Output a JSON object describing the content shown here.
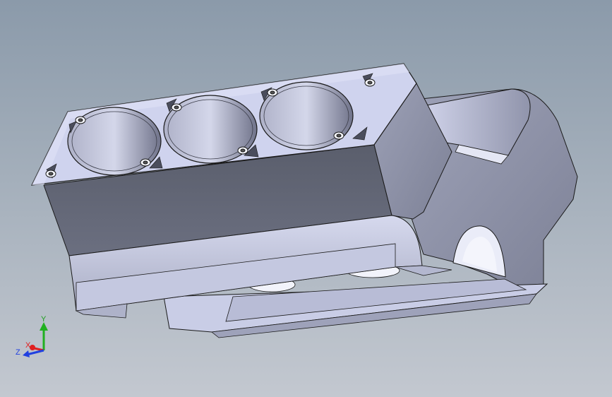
{
  "viewport": {
    "background_top": "#8b9aaa",
    "background_bottom": "#c3c8d0",
    "model": {
      "part": "engine-block",
      "cylinder_count": 3,
      "body_color": "#c9cdeb",
      "shadow_color": "#5d6170",
      "edge_color": "#1a1a1a"
    },
    "triad": {
      "x_label": "X",
      "y_label": "Y",
      "z_label": "Z",
      "x_color": "#e02020",
      "y_color": "#20b020",
      "z_color": "#2040e0"
    }
  }
}
